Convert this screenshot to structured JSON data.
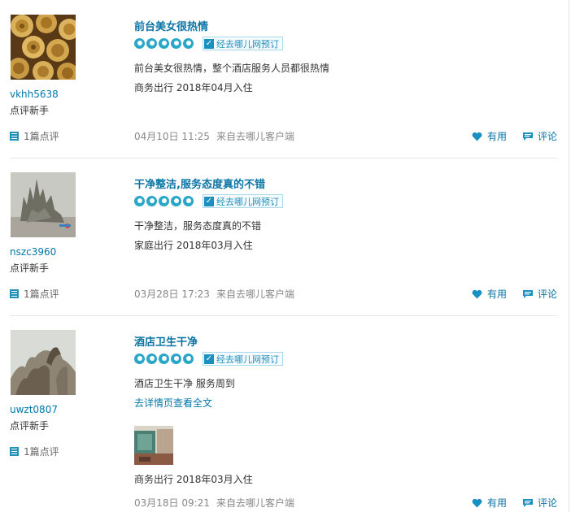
{
  "reviews": [
    {
      "user": "vkhh5638",
      "level": "点评新手",
      "review_count": "1篇点评",
      "title": "前台美女很热情",
      "badge": "经去哪儿网预订",
      "content": "前台美女很热情，整个酒店服务人员都很热情",
      "link": "",
      "trip": "商务出行 2018年04月入住",
      "date": "04月10日 11:25",
      "source": "来自去哪儿客户端",
      "useful": "有用",
      "comment": "评论",
      "rating": 5,
      "avatar_icon": "golden-roses-photo"
    },
    {
      "user": "nszc3960",
      "level": "点评新手",
      "review_count": "1篇点评",
      "title": "干净整洁,服务态度真的不错",
      "badge": "经去哪儿网预订",
      "content": "干净整洁，服务态度真的不错",
      "link": "",
      "trip": "家庭出行 2018年03月入住",
      "date": "03月28日 17:23",
      "source": "来自去哪儿客户端",
      "useful": "有用",
      "comment": "评论",
      "rating": 5,
      "avatar_icon": "sand-castle-photo"
    },
    {
      "user": "uwzt0807",
      "level": "点评新手",
      "review_count": "1篇点评",
      "title": "酒店卫生干净",
      "badge": "经去哪儿网预订",
      "content": "酒店卫生干净 服务周到",
      "link": "去详情页查看全文",
      "trip": "商务出行 2018年03月入住",
      "date": "03月18日 09:21",
      "source": "来自去哪儿客户端",
      "useful": "有用",
      "comment": "评论",
      "rating": 5,
      "avatar_icon": "driftwood-photo"
    }
  ],
  "colors": {
    "accent": "#0a74a4",
    "star": "#2aa6c8",
    "meta": "#888888"
  }
}
